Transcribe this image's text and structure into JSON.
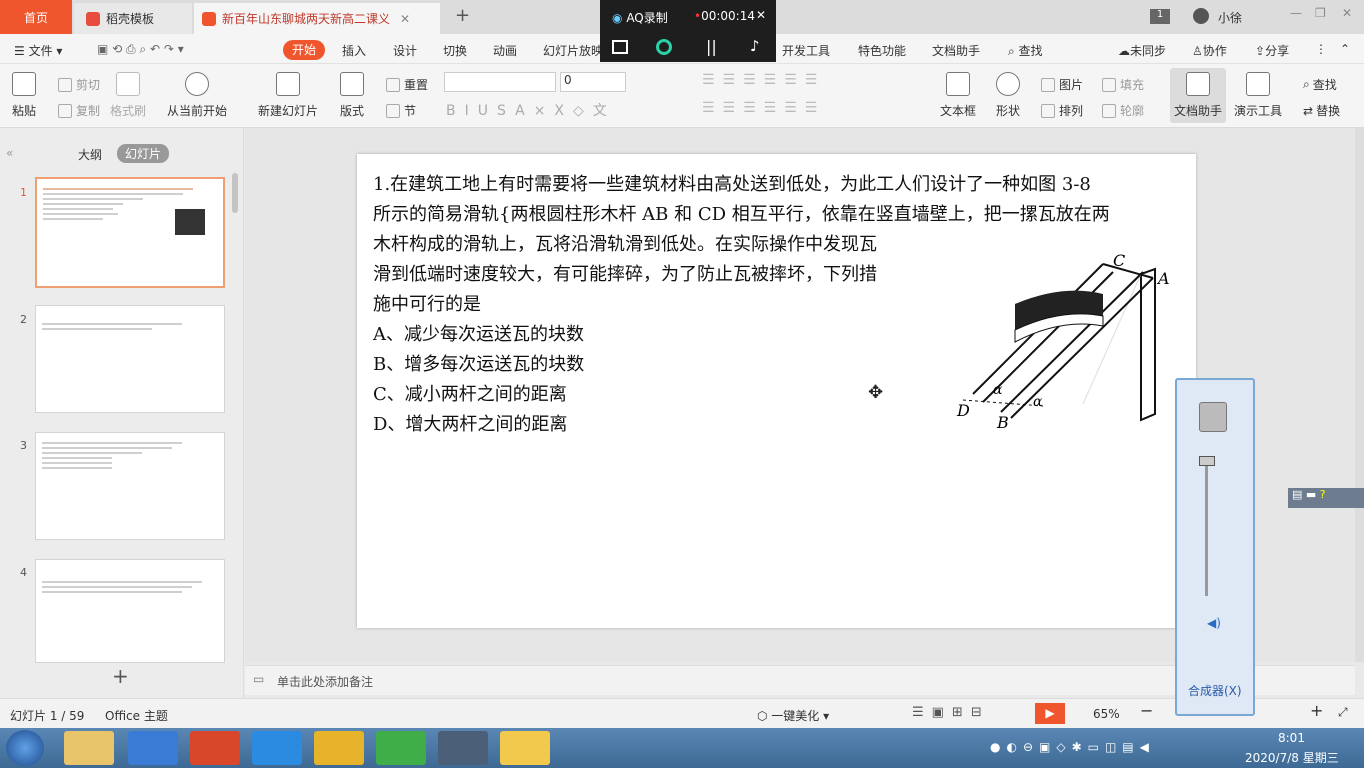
{
  "tabs": {
    "home": "首页",
    "template": "稻壳模板",
    "document": "新百年山东聊城两天新高二课义"
  },
  "user": {
    "name": "小徐"
  },
  "recorder": {
    "title": "AQ录制",
    "time": "00:00:14"
  },
  "menu": {
    "file": "文件",
    "start": "开始",
    "insert": "插入",
    "design": "设计",
    "switch": "切换",
    "animation": "动画",
    "slideshow": "幻灯片放映",
    "devtools": "开发工具",
    "feature": "特色功能",
    "dochelper": "文档助手",
    "search": "查找",
    "unsync": "未同步",
    "collab": "协作",
    "share": "分享"
  },
  "ribbon": {
    "paste": "粘贴",
    "cut": "剪切",
    "copy": "复制",
    "format_painter": "格式刷",
    "from_current": "从当前开始",
    "new_slide": "新建幻灯片",
    "layout": "版式",
    "reset": "重置",
    "section": "节",
    "font_size": "0",
    "textbox": "文本框",
    "shape": "形状",
    "picture": "图片",
    "fill": "填充",
    "arrange": "排列",
    "outline": "轮廓",
    "doc_helper": "文档助手",
    "present_tool": "演示工具",
    "find": "查找",
    "replace": "替换"
  },
  "pane": {
    "outline_tab": "大纲",
    "slides_tab": "幻灯片"
  },
  "thumbs": [
    {
      "num": "1"
    },
    {
      "num": "2"
    },
    {
      "num": "3"
    },
    {
      "num": "4"
    }
  ],
  "slide": {
    "line1": "1.在建筑工地上有时需要将一些建筑材料由高处送到低处，为此工人们设计了一种如图 3-8",
    "line2": "所示的简易滑轨{两根圆柱形木杆 AB 和 CD 相互平行，依靠在竖直墙壁上，把一摞瓦放在两",
    "line3": "木杆构成的滑轨上，瓦将沿滑轨滑到低处。在实际操作中发现瓦",
    "line4": "滑到低端时速度较大，有可能摔碎，为了防止瓦被摔坏，下列措",
    "line5": "施中可行的是",
    "optA": "A、减少每次运送瓦的块数",
    "optB": "B、增多每次运送瓦的块数",
    "optC": "C、减小两杆之间的距离",
    "optD": "D、增大两杆之间的距离",
    "labels": {
      "C": "C",
      "A": "A",
      "D": "D",
      "B": "B",
      "alpha": "α"
    }
  },
  "notes": {
    "placeholder": "单击此处添加备注"
  },
  "status": {
    "slide": "幻灯片 1 / 59",
    "theme": "Office 主题",
    "beautify": "一键美化",
    "zoom": "65%"
  },
  "mixer": {
    "label": "合成器(X)"
  },
  "clock": {
    "time": "8:01",
    "date": "2020/7/8 星期三"
  },
  "colors": {
    "accent": "#f0562e",
    "taskbar": "#3d6994"
  }
}
